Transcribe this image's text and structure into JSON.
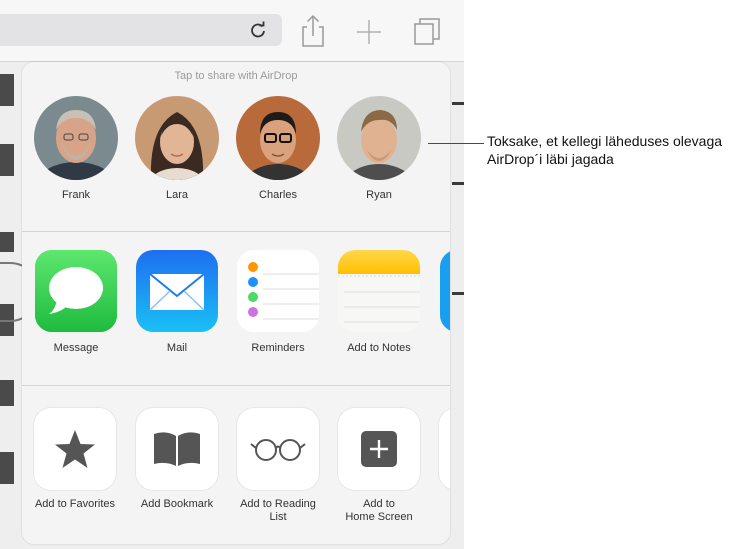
{
  "airdrop": {
    "title": "Tap to share with AirDrop",
    "people": [
      {
        "name": "Frank"
      },
      {
        "name": "Lara"
      },
      {
        "name": "Charles"
      },
      {
        "name": "Ryan"
      }
    ]
  },
  "apps": [
    {
      "label": "Message",
      "icon": "messages-icon"
    },
    {
      "label": "Mail",
      "icon": "mail-icon"
    },
    {
      "label": "Reminders",
      "icon": "reminders-icon"
    },
    {
      "label": "Add to Notes",
      "icon": "notes-icon"
    }
  ],
  "actions": [
    {
      "label": "Add to Favorites",
      "icon": "star-icon"
    },
    {
      "label": "Add Bookmark",
      "icon": "book-icon"
    },
    {
      "label": "Add to Reading\nList",
      "icon": "glasses-icon"
    },
    {
      "label": "Add to\nHome Screen",
      "icon": "plus-square-icon"
    }
  ],
  "callout": {
    "text": "Toksake, et kellegi läheduses olevaga AirDrop´i läbi jagada"
  },
  "colors": {
    "messages_green": "#34c759",
    "mail_blue": "#1a8cf0",
    "notes_yellow": "#ffcc00",
    "icon_gray": "#555555"
  }
}
